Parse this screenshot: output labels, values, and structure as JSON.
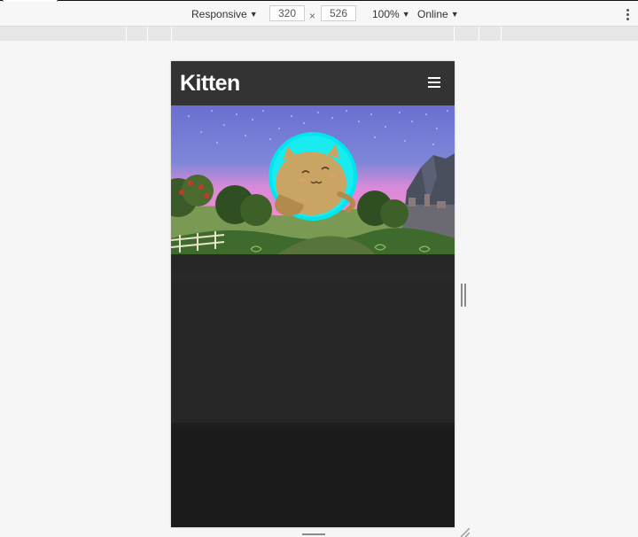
{
  "devtools": {
    "device_label": "Responsive",
    "width_value": "320",
    "times": "×",
    "height_value": "526",
    "zoom_label": "100%",
    "network_label": "Online"
  },
  "site": {
    "brand": "Kitten",
    "menu_icon": "hamburger-menu-icon",
    "hero_image": "cat-in-glowing-orb-over-landscape"
  },
  "colors": {
    "appbar": "#333333",
    "page_bg": "#262626",
    "orb": "#00e5ee",
    "sky_top": "#6a6fd0",
    "sky_bottom": "#ee8ad8"
  }
}
